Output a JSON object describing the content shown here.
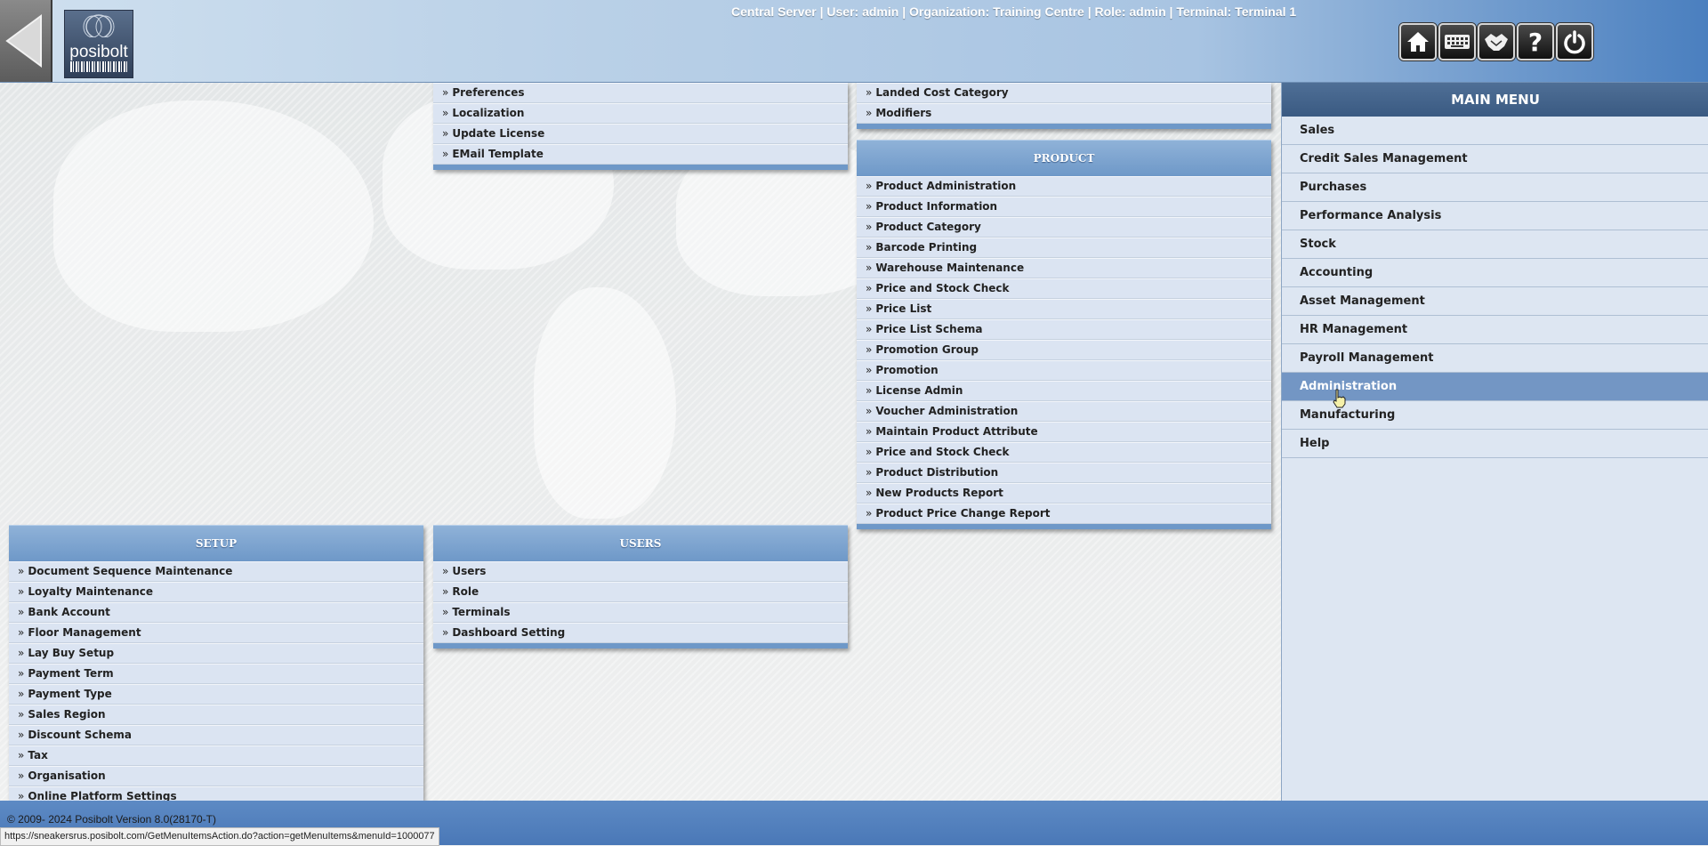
{
  "header": {
    "session_info": "Central Server | User: admin | Organization: Training Centre | Role: admin | Terminal: Terminal 1",
    "logo_text": "posibolt",
    "buttons": [
      "home-icon",
      "keyboard-icon",
      "handshake-icon",
      "help-icon",
      "power-icon"
    ]
  },
  "panels": {
    "administration": {
      "items": [
        "Preferences",
        "Localization",
        "Update License",
        "EMail Template"
      ]
    },
    "misc": {
      "items": [
        "Landed Cost Category",
        "Modifiers"
      ]
    },
    "product": {
      "title": "PRODUCT",
      "items": [
        "Product Administration",
        "Product Information",
        "Product Category",
        "Barcode Printing",
        "Warehouse Maintenance",
        "Price and Stock Check",
        "Price List",
        "Price List Schema",
        "Promotion Group",
        "Promotion",
        "License Admin",
        "Voucher Administration",
        "Maintain Product Attribute",
        "Price and Stock Check",
        "Product Distribution",
        "New Products Report",
        "Product Price Change Report"
      ]
    },
    "setup": {
      "title": "SETUP",
      "items": [
        "Document Sequence Maintenance",
        "Loyalty Maintenance",
        "Bank Account",
        "Floor Management",
        "Lay Buy Setup",
        "Payment Term",
        "Payment Type",
        "Sales Region",
        "Discount Schema",
        "Tax",
        "Organisation",
        "Online Platform Settings"
      ]
    },
    "users": {
      "title": "USERS",
      "items": [
        "Users",
        "Role",
        "Terminals",
        "Dashboard Setting"
      ]
    }
  },
  "main_menu": {
    "title": "MAIN MENU",
    "items": [
      "Sales",
      "Credit Sales Management",
      "Purchases",
      "Performance Analysis",
      "Stock",
      "Accounting",
      "Asset Management",
      "HR Management",
      "Payroll Management",
      "Administration",
      "Manufacturing",
      "Help"
    ],
    "active": "Administration"
  },
  "footer": {
    "copyright": "© 2009- 2024 Posibolt Version  8.0(28170-T)",
    "status_url": "https://sneakersrus.posibolt.com/GetMenuItemsAction.do?action=getMenuItems&menuId=1000077"
  },
  "colors": {
    "accent": "#6e98c8",
    "active_item": "#7396c4",
    "main_menu_title": "#3a5a82"
  }
}
